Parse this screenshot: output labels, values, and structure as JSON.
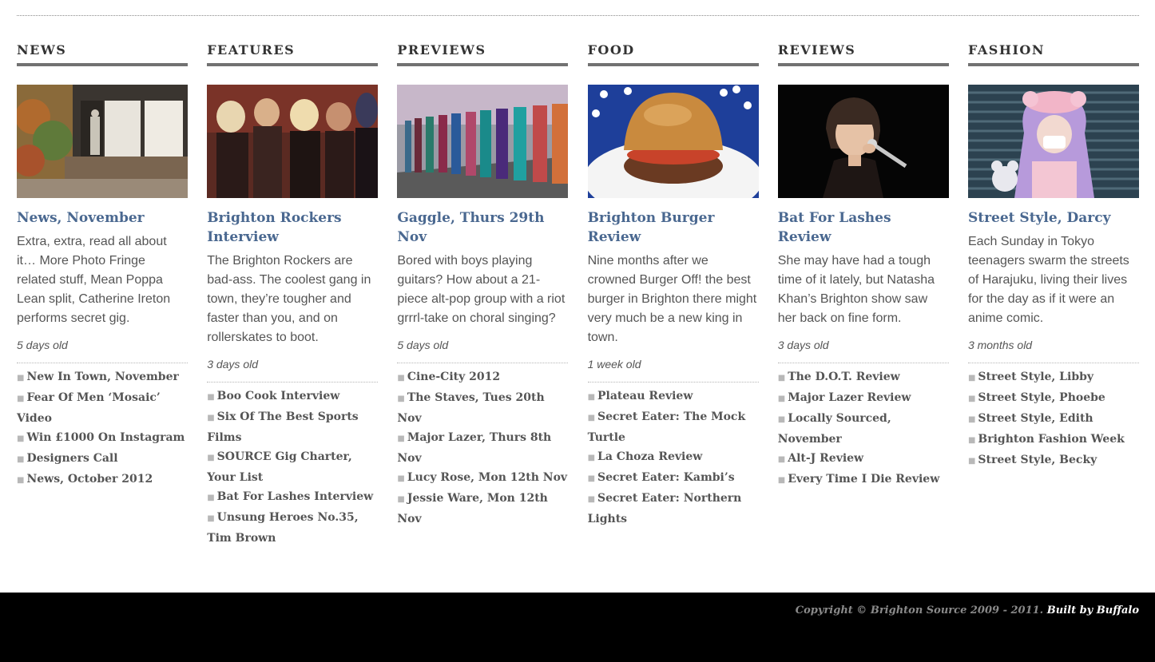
{
  "columns": [
    {
      "heading": "NEWS",
      "headline": "News, November",
      "excerpt": "Extra, extra, read all about it… More Photo Fringe related stuff, Mean Poppa Lean split, Catherine Ireton performs secret gig.",
      "age": "5 days old",
      "links": [
        "New In Town, November",
        "Fear Of Men ‘Mosaic’ Video",
        "Win £1000 On Instagram",
        "Designers Call",
        "News, October 2012"
      ]
    },
    {
      "heading": "FEATURES",
      "headline": "Brighton Rockers Interview",
      "excerpt": "The Brighton Rockers are bad-ass. The coolest gang in town, they’re tougher and faster than you, and on rollerskates to boot.",
      "age": "3 days old",
      "links": [
        "Boo Cook Interview",
        "Six Of The Best Sports Films",
        "SOURCE Gig Charter, Your List",
        "Bat For Lashes Interview",
        "Unsung Heroes No.35, Tim Brown"
      ]
    },
    {
      "heading": "PREVIEWS",
      "headline": "Gaggle, Thurs 29th Nov",
      "excerpt": "Bored with boys playing guitars? How about a 21-piece alt-pop group with a riot grrrl-take on choral singing?",
      "age": "5 days old",
      "links": [
        "Cine-City 2012",
        "The Staves, Tues 20th Nov",
        "Major Lazer, Thurs 8th Nov",
        "Lucy Rose, Mon 12th Nov",
        "Jessie Ware, Mon 12th Nov"
      ]
    },
    {
      "heading": "FOOD",
      "headline": "Brighton Burger Review",
      "excerpt": "Nine months after we crowned Burger Off! the best burger in Brighton there might very much be a new king in town.",
      "age": "1 week old",
      "links": [
        "Plateau Review",
        "Secret Eater: The Mock Turtle",
        "La Choza Review",
        "Secret Eater: Kambi’s",
        "Secret Eater: Northern Lights"
      ]
    },
    {
      "heading": "REVIEWS",
      "headline": "Bat For Lashes Review",
      "excerpt": "She may have had a tough time of it lately, but Natasha Khan’s Brighton show saw her back on fine form.",
      "age": "3 days old",
      "links": [
        "The D.O.T. Review",
        "Major Lazer Review",
        "Locally Sourced, November",
        "Alt-J Review",
        "Every Time I Die Review"
      ]
    },
    {
      "heading": "FASHION",
      "headline": "Street Style, Darcy",
      "excerpt": "Each Sunday in Tokyo teenagers swarm the streets of Harajuku, living their lives for the day as if it were an anime comic.",
      "age": "3 months old",
      "links": [
        "Street Style, Libby",
        "Street Style, Phoebe",
        "Street Style, Edith",
        "Brighton Fashion Week",
        "Street Style, Becky"
      ]
    }
  ],
  "footer": {
    "copyright": "Copyright © Brighton Source 2009 - 2011.",
    "built_by": "Built by Buffalo"
  },
  "colors": {
    "headline": "#4a6890",
    "heading_rule": "#727272",
    "footer_bg": "#000000"
  }
}
